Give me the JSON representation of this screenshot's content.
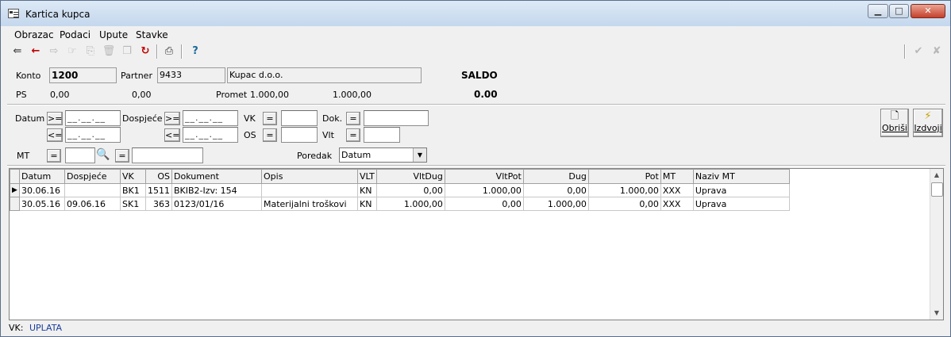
{
  "window": {
    "title": "Kartica kupca",
    "buttons": {
      "minimize": "▁",
      "maximize": "□",
      "close": "✕"
    }
  },
  "menu": [
    "Obrazac",
    "Podaci",
    "Upute",
    "Stavke"
  ],
  "toolbar": {
    "icons": [
      "exit-icon",
      "back-arrow-icon",
      "forward-arrow-icon",
      "point-icon",
      "copy-icon",
      "delete-icon",
      "duplicate-icon",
      "refresh-icon",
      "print-icon",
      "help-icon",
      "confirm-icon",
      "cancel-icon"
    ]
  },
  "header": {
    "konto_label": "Konto",
    "konto_value": "1200",
    "partner_label": "Partner",
    "partner_code": "9433",
    "partner_name": "Kupac d.o.o.",
    "saldo_label": "SALDO",
    "ps_label": "PS",
    "ps_dug": "0,00",
    "ps_pot": "0,00",
    "promet_label": "Promet",
    "promet_dug": "1.000,00",
    "promet_pot": "1.000,00",
    "saldo_value": "0.00"
  },
  "filters": {
    "datum_label": "Datum",
    "dospijece_label": "Dospjeće",
    "vk_label": "VK",
    "os_label": "OS",
    "dok_label": "Dok.",
    "vlt_label": "Vlt",
    "mt_label": "MT",
    "poredak_label": "Poredak",
    "poredak_value": "Datum",
    "op_ge": ">=",
    "op_le": "<=",
    "op_eq": "=",
    "date_mask": "__.__.__"
  },
  "actions": {
    "obrisi": "Obriši",
    "izdvoji": "Izdvoji"
  },
  "table": {
    "columns": [
      "Datum",
      "Dospjeće",
      "VK",
      "OS",
      "Dokument",
      "Opis",
      "VLT",
      "VltDug",
      "VltPot",
      "Dug",
      "Pot",
      "MT",
      "Naziv MT"
    ],
    "rows": [
      [
        "30.06.16",
        "",
        "BK1",
        "1511",
        "BKIB2-Izv: 154",
        "",
        "KN",
        "0,00",
        "1.000,00",
        "0,00",
        "1.000,00",
        "XXX",
        "Uprava"
      ],
      [
        "30.05.16",
        "09.06.16",
        "SK1",
        "363",
        "0123/01/16",
        "Materijalni troškovi",
        "KN",
        "1.000,00",
        "0,00",
        "1.000,00",
        "0,00",
        "XXX",
        "Uprava"
      ]
    ]
  },
  "status": {
    "label": "VK:",
    "value": "UPLATA"
  },
  "colors": {
    "accent": "#1a3d9c",
    "error_red": "#cc0000"
  }
}
